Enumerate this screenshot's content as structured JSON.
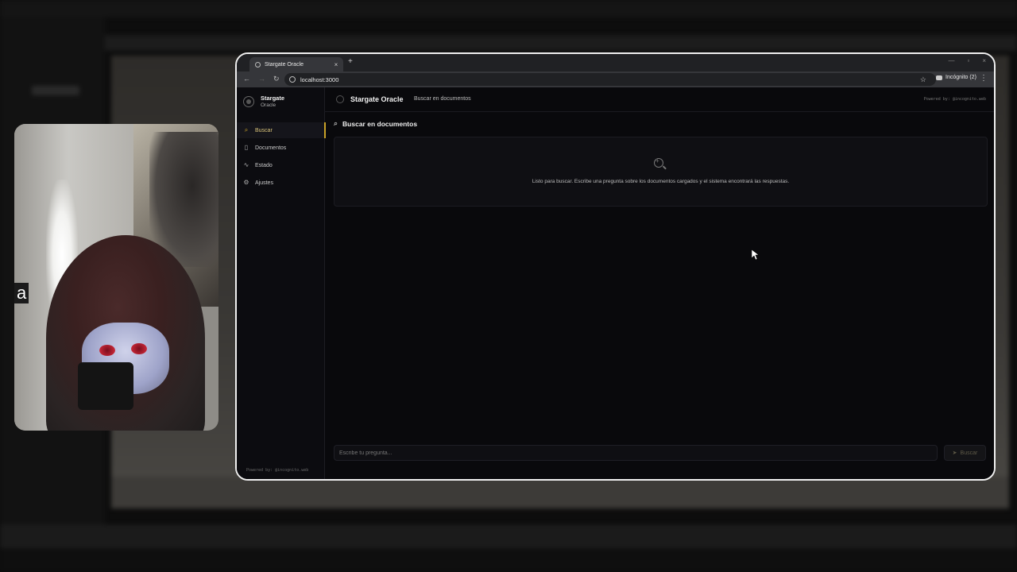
{
  "browser": {
    "tab_title": "Stargate Oracle",
    "tab_close": "×",
    "new_tab": "+",
    "window_controls": [
      "—",
      "▫",
      "×"
    ],
    "url": "localhost:3000",
    "incognito": "Incógnito (2)"
  },
  "sidebar": {
    "brand_line1": "Stargate",
    "brand_line2": "Oracle",
    "items": [
      {
        "label": "Buscar",
        "icon": "search-icon",
        "active": true
      },
      {
        "label": "Documentos",
        "icon": "document-icon",
        "active": false
      },
      {
        "label": "Estado",
        "icon": "activity-icon",
        "active": false
      },
      {
        "label": "Ajustes",
        "icon": "gear-icon",
        "active": false
      }
    ],
    "powered": "Powered by: @incognito.web"
  },
  "header": {
    "title": "Stargate Oracle",
    "subtitle": "Buscar en documentos",
    "powered": "Powered by: @incognito.web"
  },
  "main": {
    "title": "Buscar en documentos",
    "empty_message": "Listo para buscar. Escribe una pregunta sobre los documentos cargados y el sistema encontrará las respuestas."
  },
  "query": {
    "placeholder": "Escribe tu pregunta...",
    "button": "Buscar"
  },
  "webcam": {
    "caption": "a"
  },
  "colors": {
    "accent": "#c9a227",
    "background": "#09090c",
    "sidebar": "#0c0c10"
  }
}
